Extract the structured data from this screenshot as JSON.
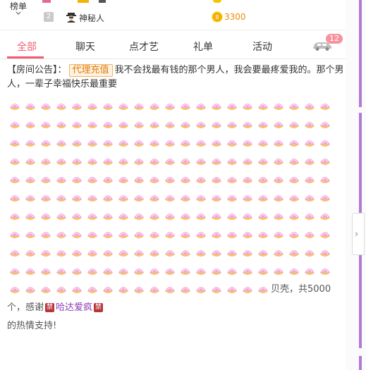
{
  "leaderboard": {
    "label": "榜单",
    "rank": "2",
    "name": "神秘人",
    "coins": "3300",
    "colors": {
      "coin": "#f08a00"
    }
  },
  "tabs": [
    {
      "label": "全部",
      "active": true
    },
    {
      "label": "聊天",
      "active": false
    },
    {
      "label": "点才艺",
      "active": false
    },
    {
      "label": "礼单",
      "active": false
    },
    {
      "label": "活动",
      "active": false
    }
  ],
  "car_badge": "12",
  "announcement": {
    "prefix": "【房间公告】：",
    "agent_label": "代理充值",
    "text": "我不会找最有钱的那个男人，我会要最疼爱我的。那个男人，一辈子幸福快乐最重要"
  },
  "gift_message": {
    "gift_icon": "shell-icon",
    "text": "贝壳，共5000个，感谢",
    "badge": "禁",
    "user": "哈达爱疯",
    "suffix": "的热情支持!"
  },
  "accent_color": "#f35b6e",
  "frame_color": "#b07ad6"
}
